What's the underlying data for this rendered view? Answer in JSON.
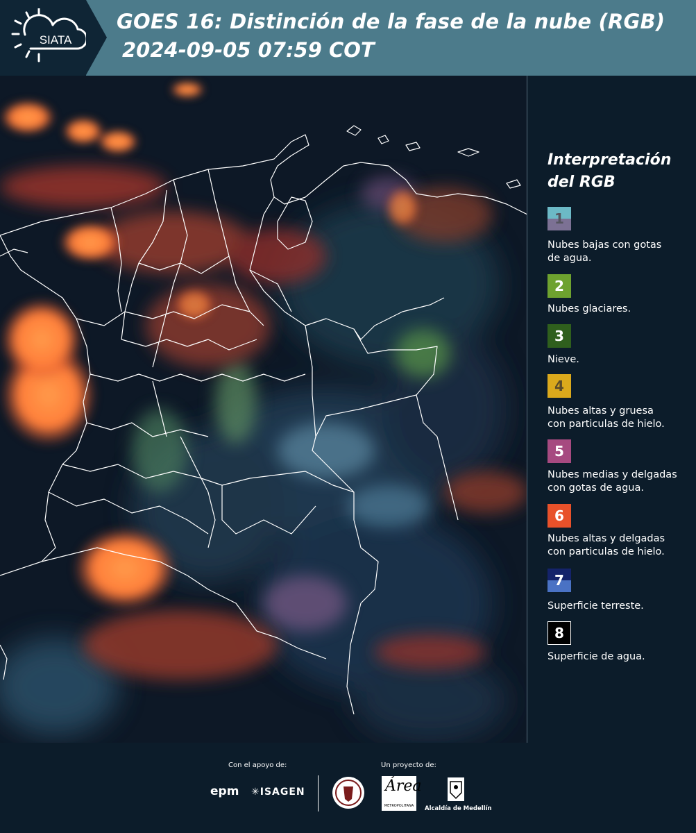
{
  "header": {
    "logo_text": "SIATA",
    "title_line1": "GOES 16: Distinción de la fase de la nube (RGB)",
    "title_line2": "2024-09-05 07:59 COT"
  },
  "legend": {
    "title": "Interpretación del RGB",
    "items": [
      {
        "number": "1",
        "label_lines": [
          "Nubes bajas con gotas",
          "de agua."
        ],
        "color_top": "#6cb9c6",
        "color_bottom": "#7c7194",
        "number_color": "#55555f"
      },
      {
        "number": "2",
        "label_lines": [
          "Nubes glaciares."
        ],
        "color_top": "#6ea22f",
        "color_bottom": "#6ea22f",
        "number_color": "#ffffff"
      },
      {
        "number": "3",
        "label_lines": [
          "Nieve."
        ],
        "color_top": "#2f5f1d",
        "color_bottom": "#2f5f1d",
        "number_color": "#ffffff"
      },
      {
        "number": "4",
        "label_lines": [
          "Nubes altas y gruesa",
          "con particulas de hielo."
        ],
        "color_top": "#dba91c",
        "color_bottom": "#dba91c",
        "number_color": "#5a4a2a"
      },
      {
        "number": "5",
        "label_lines": [
          "Nubes medias y delgadas",
          "con gotas de agua."
        ],
        "color_top": "#a64a80",
        "color_bottom": "#a64a80",
        "number_color": "#ffffff"
      },
      {
        "number": "6",
        "label_lines": [
          "Nubes altas y delgadas",
          "con particulas de hielo."
        ],
        "color_top": "#e8512a",
        "color_bottom": "#e8512a",
        "number_color": "#ffffff"
      },
      {
        "number": "7",
        "label_lines": [
          "Superficie terreste."
        ],
        "color_top": "#14236a",
        "color_bottom": "#4a72c4",
        "number_color": "#ffffff"
      },
      {
        "number": "8",
        "label_lines": [
          "Superficie de agua."
        ],
        "color_top": "#000000",
        "color_bottom": "#000000",
        "number_color": "#ffffff"
      }
    ]
  },
  "footer": {
    "support_label": "Con el apoyo de:",
    "project_label": "Un proyecto de:",
    "sponsors": [
      "epm",
      "ISAGEN"
    ],
    "area_logo_text": "METROPOLITANA",
    "alcaldia_label": "Alcaldía de Medellín"
  }
}
